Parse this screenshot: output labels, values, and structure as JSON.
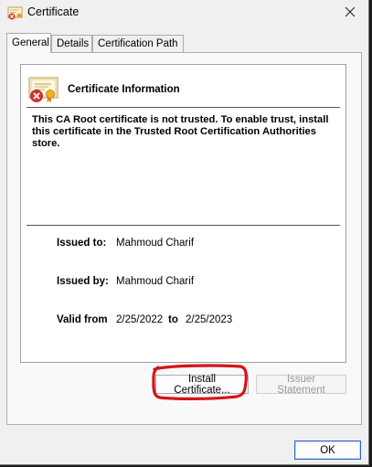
{
  "window": {
    "title": "Certificate"
  },
  "tabs": [
    {
      "label": "General"
    },
    {
      "label": "Details"
    },
    {
      "label": "Certification Path"
    }
  ],
  "general": {
    "info_title": "Certificate Information",
    "warning": "This CA Root certificate is not trusted. To enable trust, install this certificate in the Trusted Root Certification Authorities store.",
    "issued_to_label": "Issued to:",
    "issued_to_value": "Mahmoud Charif",
    "issued_by_label": "Issued by:",
    "issued_by_value": "Mahmoud Charif",
    "valid_from_label": "Valid from",
    "valid_from_value": "2/25/2022",
    "valid_to_label": "to",
    "valid_to_value": "2/25/2023"
  },
  "buttons": {
    "install": "Install Certificate...",
    "issuer_statement": "Issuer Statement",
    "ok": "OK"
  },
  "icons": {
    "title": "certificate-icon",
    "close": "close-icon",
    "cert_info": "untrusted-certificate-icon"
  },
  "colors": {
    "annotation": "#d4141a",
    "primary_border": "#2c63c4"
  }
}
